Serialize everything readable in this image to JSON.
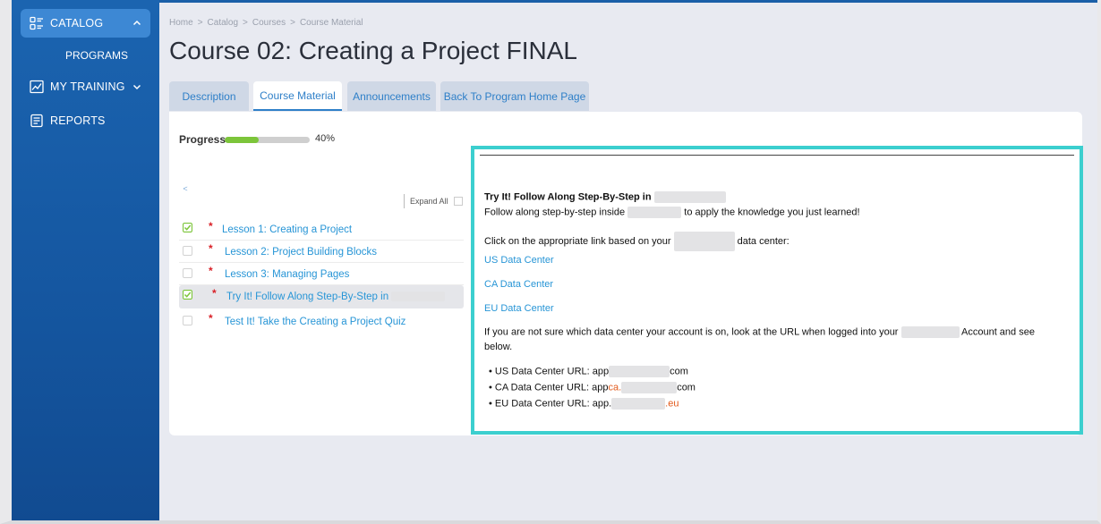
{
  "sidebar": {
    "items": [
      {
        "label": "CATALOG",
        "icon": "catalog-icon",
        "active": true
      },
      {
        "label": "PROGRAMS"
      },
      {
        "label": "MY TRAINING",
        "icon": "chart-line-icon"
      },
      {
        "label": "REPORTS",
        "icon": "report-icon"
      }
    ]
  },
  "breadcrumb": [
    "Home",
    "Catalog",
    "Courses",
    "Course Material"
  ],
  "breadcrumb_sep": ">",
  "page_title": "Course 02: Creating a Project FINAL",
  "tabs": [
    {
      "label": "Description"
    },
    {
      "label": "Course Material",
      "active": true
    },
    {
      "label": "Announcements"
    },
    {
      "label": "Back To Program Home Page"
    }
  ],
  "progress": {
    "label": "Progress",
    "value": 40,
    "text": "40%"
  },
  "collapse_label": "<",
  "expand_all_label": "Expand All",
  "lessons": [
    {
      "label": "Lesson 1: Creating a Project",
      "completed": true
    },
    {
      "label": "Lesson 2: Project Building Blocks",
      "completed": false
    },
    {
      "label": "Lesson 3: Managing Pages",
      "completed": false
    },
    {
      "label": "Try It! Follow Along Step-By-Step in",
      "completed": true,
      "selected": true
    },
    {
      "label": "Test It! Take the Creating a Project Quiz",
      "completed": false
    }
  ],
  "preview": {
    "heading": "Try It! Follow Along Step-By-Step in",
    "follow_a": "Follow along step-by-step inside",
    "follow_b": "to apply the knowledge you just learned!",
    "click_a": "Click on the appropriate link based on your",
    "click_b": "data center:",
    "links": [
      "US Data Center",
      "CA Data Center",
      "EU Data Center"
    ],
    "unsure_a": "If you are not sure which data center your account is on, look at the URL when logged into your",
    "unsure_b": "Account and see",
    "unsure_c": "below.",
    "urls": [
      {
        "label": "US Data Center URL:",
        "prefix": "app",
        "accent": "",
        "suffix": "com"
      },
      {
        "label": "CA Data Center URL:",
        "prefix": "app",
        "accent": "ca.",
        "suffix": "com"
      },
      {
        "label": "EU Data Center URL:",
        "prefix": "app.",
        "accent": ".eu",
        "suffix": ""
      }
    ],
    "bullet": "•"
  },
  "colors": {
    "sidebar": "#1557a1",
    "accent_link": "#2795d6",
    "progress_fill": "#7cc53a",
    "highlight_border": "#3ccfcf",
    "required_star": "#d91f26",
    "url_accent": "#e25a1c"
  }
}
